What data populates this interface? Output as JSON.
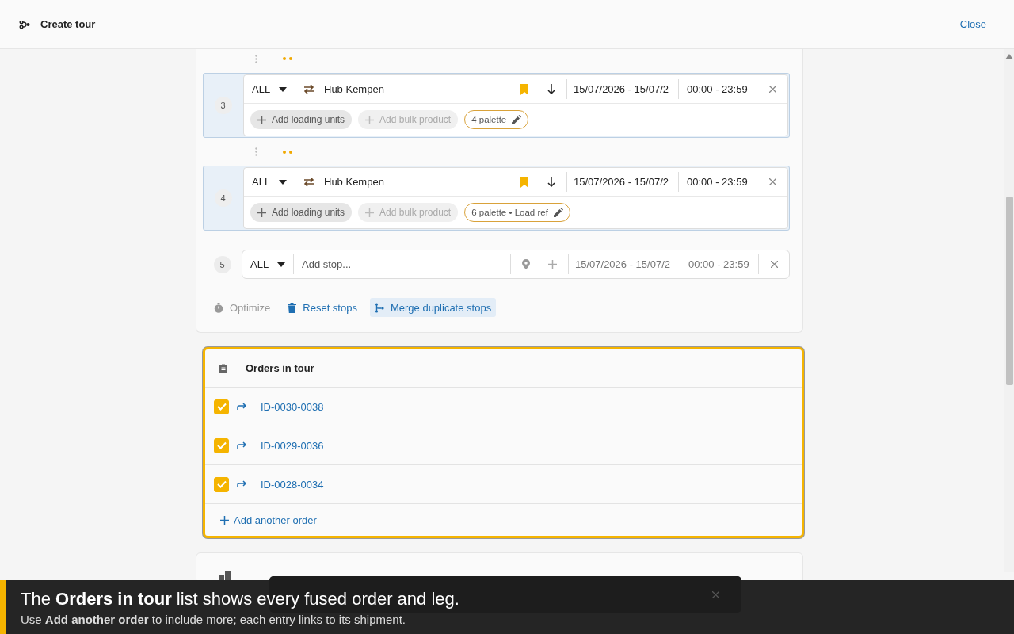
{
  "header": {
    "title": "Create tour",
    "close": "Close"
  },
  "stops": [
    {
      "kind": "stop",
      "number": "3",
      "mode": "ALL",
      "location": "Hub Kempen",
      "bookmarked": true,
      "date": "15/07/2026 - 15/07/2",
      "time": "00:00 - 23:59",
      "units": {
        "label": "Add loading units",
        "disabled": false
      },
      "bulk": {
        "label": "Add bulk product",
        "disabled": true
      },
      "load": "4 palette"
    },
    {
      "kind": "stop",
      "number": "4",
      "mode": "ALL",
      "location": "Hub Kempen",
      "bookmarked": true,
      "date": "15/07/2026 - 15/07/2",
      "time": "00:00 - 23:59",
      "units": {
        "label": "Add loading units",
        "disabled": false
      },
      "bulk": {
        "label": "Add bulk product",
        "disabled": true
      },
      "load": "6 palette • Load ref"
    },
    {
      "kind": "new",
      "number": "5",
      "mode": "ALL",
      "placeholder": "Add stop...",
      "date": "15/07/2026 - 15/07/2",
      "time": "00:00 - 23:59"
    }
  ],
  "actions": [
    {
      "kind": "optimize",
      "label": "Optimize",
      "disabled": true,
      "highlighted": false
    },
    {
      "kind": "reset",
      "label": "Reset stops",
      "disabled": false,
      "highlighted": false
    },
    {
      "kind": "merge",
      "label": "Merge duplicate stops",
      "disabled": false,
      "highlighted": true
    }
  ],
  "orders": {
    "title": "Orders in tour",
    "items": [
      {
        "id": "ID-0030-0038",
        "checked": true
      },
      {
        "id": "ID-0029-0036",
        "checked": true
      },
      {
        "id": "ID-0028-0034",
        "checked": true
      }
    ],
    "add": "Add another order"
  },
  "caption": {
    "title": "The **Orders in tour** list shows every fused order and leg.",
    "body": "Use **Add another order** to include more; each entry links to its shipment."
  }
}
